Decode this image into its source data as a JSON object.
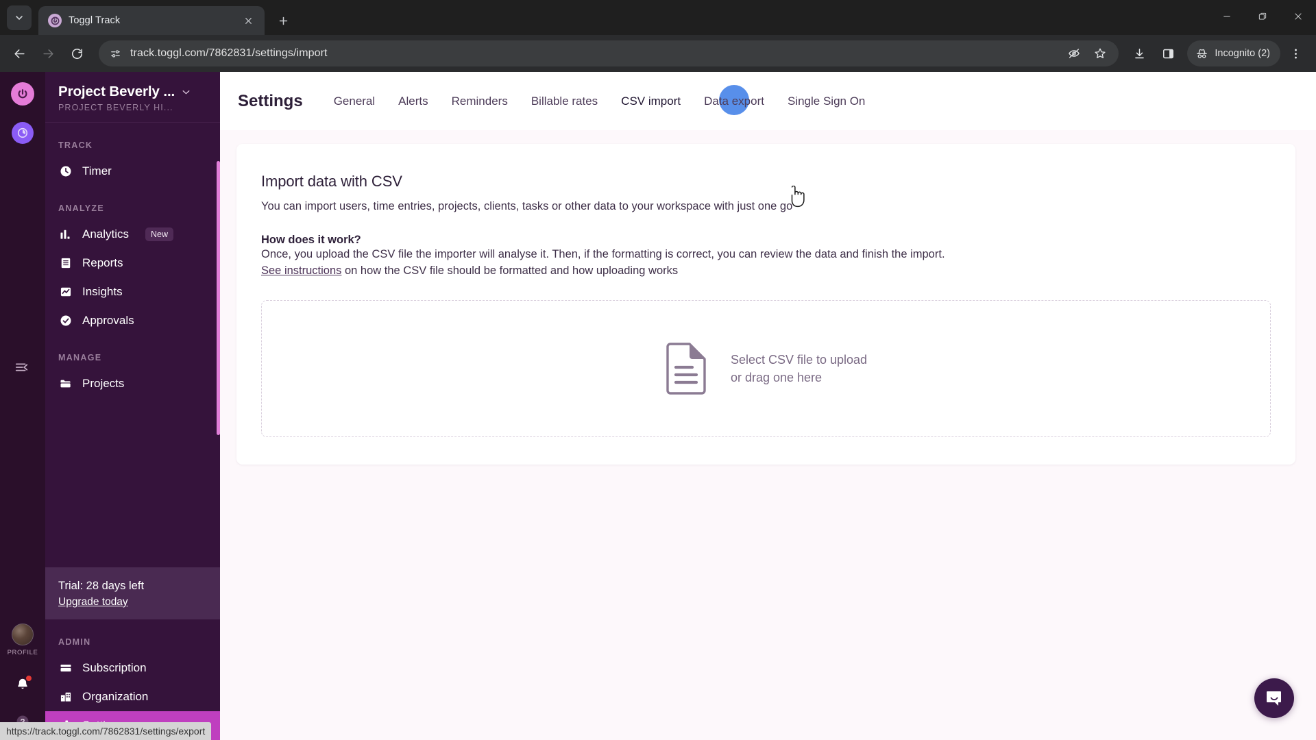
{
  "browser": {
    "tab": {
      "title": "Toggl Track",
      "favicon_icon": "toggl-power-icon"
    },
    "tab_list_icon": "chevron-down-icon",
    "new_tab_icon": "plus-icon",
    "close_tab_icon": "close-icon",
    "window_controls": {
      "minimize": "minimize-icon",
      "maximize": "restore-icon",
      "close": "close-icon"
    },
    "nav": {
      "back_icon": "arrow-left-icon",
      "forward_icon": "arrow-right-icon",
      "reload_icon": "reload-icon"
    },
    "omnibox": {
      "url": "track.toggl.com/7862831/settings/import",
      "site_info_icon": "page-settings-icon"
    },
    "actions": {
      "tracking_protection_icon": "eye-slash-icon",
      "bookmark_icon": "star-icon",
      "downloads_icon": "download-icon",
      "side_panel_icon": "side-panel-icon",
      "menu_icon": "three-dot-menu-icon"
    },
    "incognito": {
      "label": "Incognito (2)",
      "icon": "incognito-hat-icon"
    },
    "status_bar": {
      "url": "https://track.toggl.com/7862831/settings/export"
    }
  },
  "rail": {
    "logo_icon": "toggl-power-icon",
    "app_switch_icon": "toggl-clock-icon",
    "collapse_icon": "collapse-sidebar-icon",
    "profile_label": "PROFILE",
    "avatar_icon": "user-avatar",
    "notifications_icon": "bell-icon",
    "help_icon": "question-circle-icon"
  },
  "sidebar": {
    "workspace": {
      "name": "Project Beverly ...",
      "subtitle": "PROJECT BEVERLY HI...",
      "chevron_icon": "chevron-down-icon"
    },
    "sections": [
      {
        "label": "TRACK",
        "items": [
          {
            "label": "Timer",
            "icon": "clock-icon",
            "active": false,
            "badge": null
          }
        ]
      },
      {
        "label": "ANALYZE",
        "items": [
          {
            "label": "Analytics",
            "icon": "bar-chart-icon",
            "active": false,
            "badge": "New"
          },
          {
            "label": "Reports",
            "icon": "report-list-icon",
            "active": false,
            "badge": null
          },
          {
            "label": "Insights",
            "icon": "insights-chart-icon",
            "active": false,
            "badge": null
          },
          {
            "label": "Approvals",
            "icon": "check-circle-icon",
            "active": false,
            "badge": null
          }
        ]
      },
      {
        "label": "MANAGE",
        "items": [
          {
            "label": "Projects",
            "icon": "folder-icon",
            "active": false,
            "badge": null
          }
        ]
      }
    ],
    "trial": {
      "title": "Trial: 28 days left",
      "link": "Upgrade today"
    },
    "admin": {
      "label": "ADMIN",
      "items": [
        {
          "label": "Subscription",
          "icon": "credit-card-icon",
          "active": false
        },
        {
          "label": "Organization",
          "icon": "building-icon",
          "active": false
        },
        {
          "label": "Settings",
          "icon": "gear-icon",
          "active": true
        }
      ]
    }
  },
  "settings": {
    "title": "Settings",
    "tabs": [
      {
        "label": "General",
        "active": false
      },
      {
        "label": "Alerts",
        "active": false
      },
      {
        "label": "Reminders",
        "active": false
      },
      {
        "label": "Billable rates",
        "active": false
      },
      {
        "label": "CSV import",
        "active": true
      },
      {
        "label": "Data export",
        "active": false,
        "hovered": true
      },
      {
        "label": "Single Sign On",
        "active": false
      }
    ]
  },
  "main": {
    "heading": "Import data with CSV",
    "intro": "You can import users, time entries, projects, clients, tasks or other data to your workspace with just one go",
    "how_heading": "How does it work?",
    "how_body": "Once, you upload the CSV file the importer will analyse it. Then, if the formatting is correct, you can review the data and finish the import.",
    "instructions_link": "See instructions",
    "instructions_rest": " on how the CSV file should be formatted and how uploading works",
    "dropzone": {
      "icon": "csv-file-icon",
      "line1": "Select CSV file to upload",
      "line2": "or drag one here"
    }
  },
  "widgets": {
    "intercom": {
      "icon": "chat-bubble-icon"
    }
  },
  "colors": {
    "sidebar_bg": "#35133b",
    "rail_bg": "#2a0f2a",
    "accent_active": "#bf3fbf",
    "scrollbar": "#e17fd8",
    "trial_bg": "#4a2a52",
    "page_bg": "#fdf8fb",
    "cursor_highlight": "#4a86e8",
    "intercom_bg": "#3c1a4b"
  }
}
